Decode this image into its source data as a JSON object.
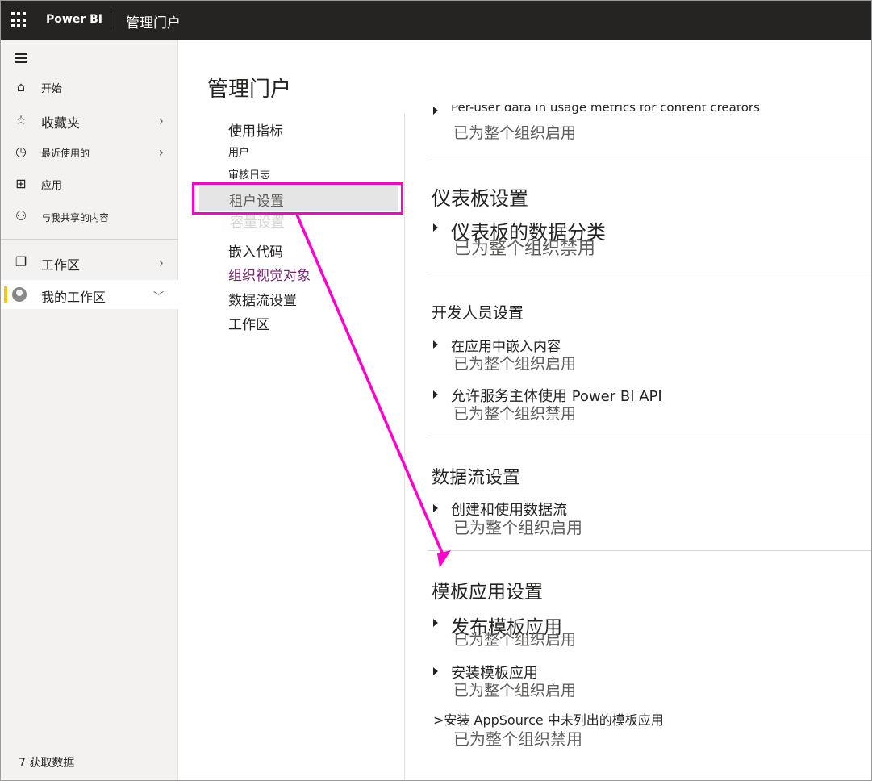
{
  "topbar": {
    "brand": "Power BI",
    "title": "管理门户"
  },
  "leftnav": {
    "items": [
      {
        "label": "开始",
        "icon": "home-icon"
      },
      {
        "label": "收藏夹",
        "icon": "star-icon"
      },
      {
        "label": "最近使用的",
        "icon": "clock-icon"
      },
      {
        "label": "应用",
        "icon": "apps-icon"
      },
      {
        "label": "与我共享的内容",
        "icon": "shared-icon"
      },
      {
        "label": "工作区",
        "icon": "workspaces-icon"
      },
      {
        "label": "我的工作区",
        "icon": "avatar-icon"
      }
    ],
    "get_data": "7 获取数据"
  },
  "page_title": "管理门户",
  "subnav": {
    "items": [
      "使用指标",
      "用户",
      "审核日志",
      "租户设置",
      "容量设置",
      "嵌入代码",
      "组织视觉对象",
      "数据流设置",
      "工作区"
    ]
  },
  "content": {
    "partial_top": {
      "name": "Per-user data in usage metrics for content creators",
      "state": "已为整个组织启用"
    },
    "sections": [
      {
        "title": "仪表板设置",
        "settings": [
          {
            "name": "仪表板的数据分类",
            "state": "已为整个组织禁用"
          }
        ]
      },
      {
        "title": "开发人员设置",
        "settings": [
          {
            "name": "在应用中嵌入内容",
            "state": "已为整个组织启用"
          },
          {
            "name": "允许服务主体使用 Power BI API",
            "state": "已为整个组织禁用"
          }
        ]
      },
      {
        "title": "数据流设置",
        "settings": [
          {
            "name": "创建和使用数据流",
            "state": "已为整个组织启用"
          }
        ]
      },
      {
        "title": "模板应用设置",
        "settings": [
          {
            "name": "发布模板应用",
            "state": "已为整个组织启用"
          },
          {
            "name": "安装模板应用",
            "state": "已为整个组织启用"
          },
          {
            "name": ">安装 AppSource 中未列出的模板应用",
            "state": "已为整个组织禁用"
          }
        ]
      }
    ]
  },
  "colors": {
    "topbar": "#252423",
    "annotation": "#ff00cc",
    "active_marker": "#f2c811",
    "visual_link": "#742774"
  }
}
